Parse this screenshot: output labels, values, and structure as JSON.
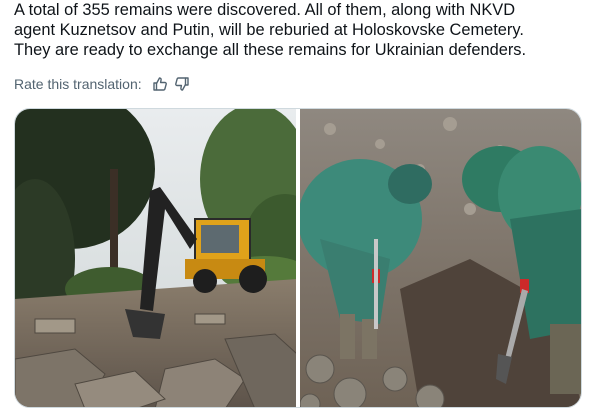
{
  "tweet": {
    "lines": [
      "A total of 355 remains were discovered. All of them, along with NKVD",
      "agent Kuznetsov and Putin, will be reburied at Holoskovske Cemetery.",
      "They are ready to exchange all these remains for Ukrainian defenders."
    ]
  },
  "translation": {
    "rate_label": "Rate this translation:",
    "thumbs_up_icon": "thumbs-up-icon",
    "thumbs_down_icon": "thumbs-down-icon"
  },
  "media": {
    "photos": [
      {
        "name": "photo-excavator-cemetery"
      },
      {
        "name": "photo-workers-in-raincoats-digging"
      }
    ]
  }
}
